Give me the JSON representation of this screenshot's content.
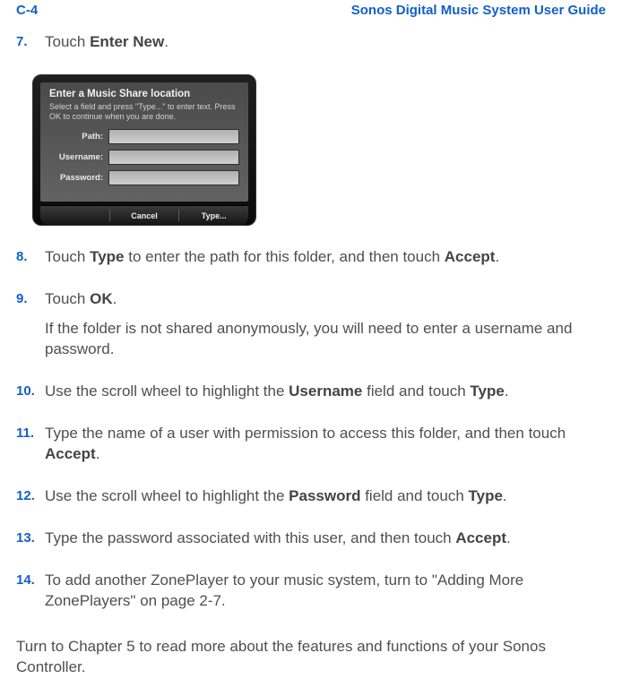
{
  "header": {
    "page_number": "C-4",
    "guide_title": "Sonos Digital Music System User Guide"
  },
  "steps": {
    "s7": {
      "num": "7.",
      "pre": "Touch ",
      "bold1": "Enter New",
      "post": "."
    },
    "s8": {
      "num": "8.",
      "t1": "Touch ",
      "b1": "Type",
      "t2": " to enter the path for this folder, and then touch ",
      "b2": "Accept",
      "t3": "."
    },
    "s9": {
      "num": "9.",
      "t1": "Touch ",
      "b1": "OK",
      "t2": ".",
      "p2": "If the folder is not shared anonymously, you will need to enter a username and password."
    },
    "s10": {
      "num": "10.",
      "t1": "Use the scroll wheel to highlight the ",
      "b1": "Username",
      "t2": " field and touch ",
      "b2": "Type",
      "t3": "."
    },
    "s11": {
      "num": "11.",
      "t1": "Type the name of a user with permission to access this folder, and then touch ",
      "b1": "Accept",
      "t2": "."
    },
    "s12": {
      "num": "12.",
      "t1": "Use the scroll wheel to highlight the ",
      "b1": "Password",
      "t2": " field and touch ",
      "b2": "Type",
      "t3": "."
    },
    "s13": {
      "num": "13.",
      "t1": "Type the password associated with this user, and then touch ",
      "b1": "Accept",
      "t2": "."
    },
    "s14": {
      "num": "14.",
      "t1": "To add another ZonePlayer to your music system, turn to \"Adding More ZonePlayers\" on page 2-7."
    }
  },
  "screenshot": {
    "title": "Enter a Music Share location",
    "sub": "Select a field and press \"Type...\" to enter text. Press OK to continue when you are done.",
    "labels": {
      "path": "Path:",
      "user": "Username:",
      "pass": "Password:"
    },
    "buttons": {
      "cancel": "Cancel",
      "type": "Type..."
    }
  },
  "closing": "Turn to Chapter 5 to read more about the features and functions of your Sonos Controller."
}
